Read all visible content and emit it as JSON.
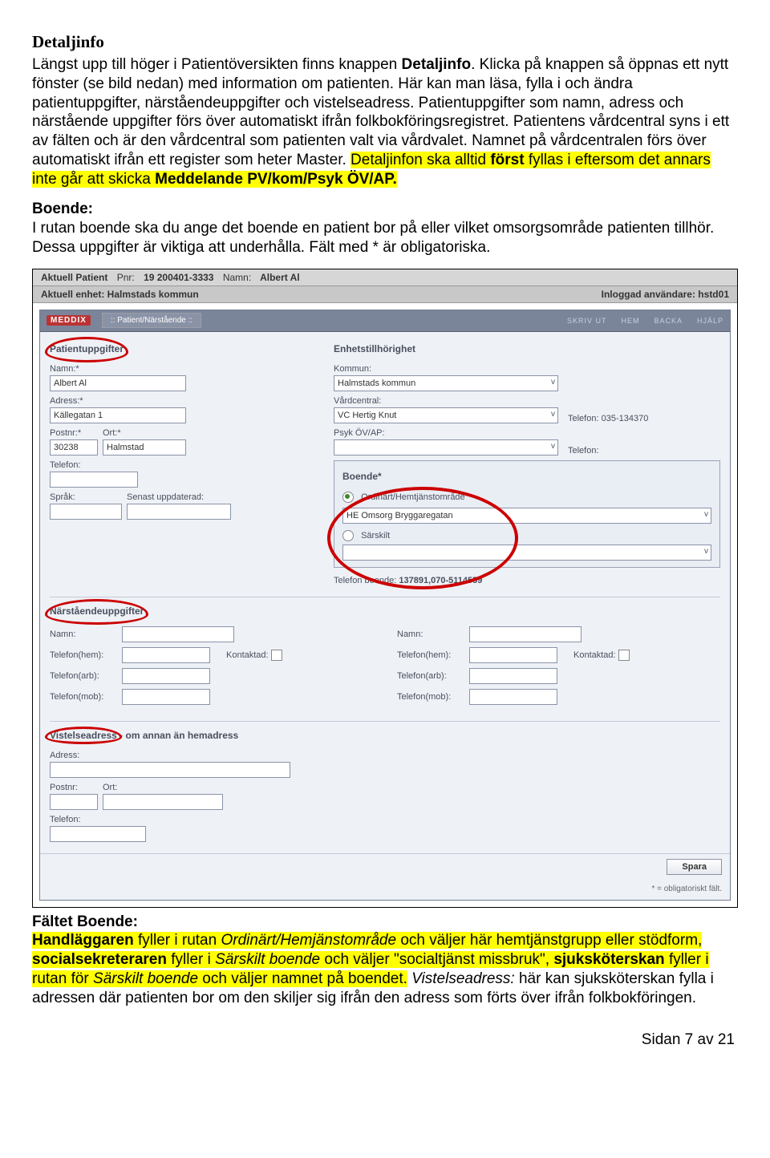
{
  "doc": {
    "title": "Detaljinfo",
    "para1_a": "Längst upp till höger i Patientöversikten finns knappen ",
    "para1_b": "Detaljinfo",
    "para1_c": ". Klicka på knappen så öppnas ett nytt fönster (se bild nedan) med information om patienten. Här kan man läsa, fylla i och ändra patientuppgifter, närståendeuppgifter och vistelseadress. Patientuppgifter som namn, adress och närstående uppgifter förs över automatiskt ifrån folkbokföringsregistret. Patientens vårdcentral syns i ett av fälten och är den vårdcentral som patienten valt via vårdvalet. Namnet på vårdcentralen förs över automatiskt ifrån ett register som heter Master. ",
    "para1_hl_a": "Detaljinfon ska alltid ",
    "para1_hl_b": "först",
    "para1_hl_c": " fyllas i eftersom det annars inte går att skicka ",
    "para1_hl_d": "Meddelande PV/kom/Psyk ÖV/AP.",
    "boende_label": "Boende:",
    "boende_text": "I rutan boende ska du ange det boende en patient bor på eller vilket omsorgsområde patienten tillhör. Dessa uppgifter är viktiga att underhålla. Fält med * är obligatoriska.",
    "after_label": "Fältet Boende:",
    "after_hl_a": "Handläggaren",
    "after_hl_b": " fyller i rutan ",
    "after_hl_c": "Ordinärt/Hemjänstområde",
    "after_hl_d": " och väljer här hemtjänstgrupp eller stödform, ",
    "after_hl_e": "socialsekreteraren",
    "after_hl_f": " fyller i ",
    "after_hl_g": "Särskilt boende",
    "after_hl_h": " och väljer \"socialtjänst missbruk\", ",
    "after_hl_i": "sjuksköterskan",
    "after_hl_j": " fyller i rutan för ",
    "after_hl_k": "Särskilt boende",
    "after_hl_l": " och väljer namnet på boendet.",
    "after_plain_a": " ",
    "after_plain_b": "Vistelseadress:",
    "after_plain_c": " här kan sjuksköterskan fylla i adressen där patienten bor om den skiljer sig ifrån den adress som förts över ifrån folkbokföringen.",
    "footer": "Sidan 7 av 21"
  },
  "bar": {
    "aktuell_patient": "Aktuell Patient",
    "pnr_label": "Pnr:",
    "pnr_value": "19 200401-3333",
    "namn_label": "Namn:",
    "namn_value": "Albert Al",
    "enhet_label": "Aktuell enhet: Halmstads kommun",
    "inloggad": "Inloggad användare: hstd01"
  },
  "top": {
    "logo": "MEDDIX",
    "tab": ":: Patient/Närstående ::",
    "r1": "SKRIV UT",
    "r2": "HEM",
    "r3": "BACKA",
    "r4": "HJÄLP"
  },
  "form": {
    "patientuppgifter": "Patientuppgifter",
    "enhet_title": "Enhetstillhörighet",
    "namn_lbl": "Namn:*",
    "namn_val": "Albert Al",
    "adress_lbl": "Adress:*",
    "adress_val": "Källegatan 1",
    "postnr_lbl": "Postnr:*",
    "postnr_val": "30238",
    "ort_lbl": "Ort:*",
    "ort_val": "Halmstad",
    "telefon_lbl": "Telefon:",
    "sprak_lbl": "Språk:",
    "senast_lbl": "Senast uppdaterad:",
    "kommun_lbl": "Kommun:",
    "kommun_val": "Halmstads kommun",
    "vardcentral_lbl": "Vårdcentral:",
    "vardcentral_val": "VC Hertig Knut",
    "vc_tel_lbl": "Telefon:",
    "vc_tel_val": "035-134370",
    "psyk_lbl": "Psyk ÖV/AP:",
    "psyk_tel_lbl": "Telefon:",
    "boende_lbl": "Boende*",
    "radio_ord": "Ordinärt/Hemtjänstområde",
    "ord_val": "HE Omsorg Bryggaregatan",
    "radio_sar": "Särskilt",
    "tel_boende_lbl": "Telefon boende:",
    "tel_boende_val": "137891,070-5114559",
    "near_title": "Närståendeuppgifter",
    "near_namn": "Namn:",
    "near_telhem": "Telefon(hem):",
    "near_telarb": "Telefon(arb):",
    "near_telmob": "Telefon(mob):",
    "kontaktad": "Kontaktad:",
    "vist_title": "Vistelseadress - om annan än hemadress",
    "vist_title_a": "Vistelseadress",
    "vist_title_b": " - om annan än hemadress",
    "vist_adress": "Adress:",
    "vist_postnr": "Postnr:",
    "vist_ort": "Ort:",
    "vist_tel": "Telefon:",
    "spara": "Spara",
    "oblig": "* = obligatoriskt fält."
  }
}
